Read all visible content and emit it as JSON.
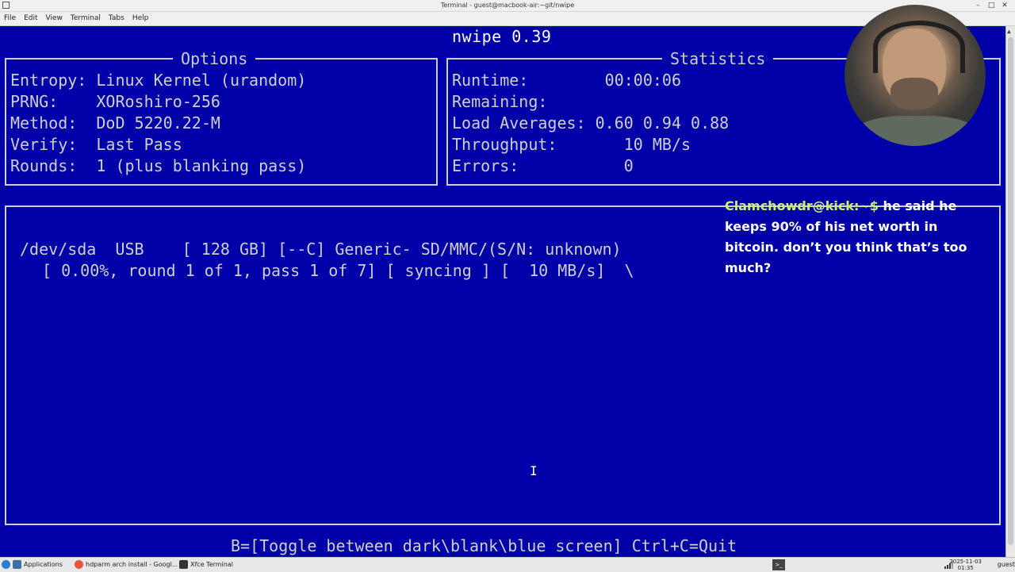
{
  "window": {
    "title": "Terminal - guest@macbook-air:~git/nwipe",
    "controls": [
      "–",
      "□",
      "✕"
    ]
  },
  "menu": [
    "File",
    "Edit",
    "View",
    "Terminal",
    "Tabs",
    "Help"
  ],
  "app": {
    "title": "nwipe 0.39"
  },
  "options": {
    "header": "Options",
    "rows": [
      "Entropy: Linux Kernel (urandom)",
      "PRNG:    XORoshiro-256",
      "Method:  DoD 5220.22-M",
      "Verify:  Last Pass",
      "Rounds:  1 (plus blanking pass)"
    ]
  },
  "statistics": {
    "header": "Statistics",
    "rows": [
      "Runtime:        00:00:06",
      "Remaining:",
      "Load Averages: 0.60 0.94 0.88",
      "Throughput:       10 MB/s",
      "Errors:           0"
    ]
  },
  "device": {
    "line1": "/dev/sda  USB    [ 128 GB] [--C] Generic- SD/MMC/(S/N: unknown)",
    "line2": "[ 0.00%, round 1 of 1, pass 1 of 7] [ syncing ] [  10 MB/s]  \\"
  },
  "footer": "B=[Toggle between dark\\blank\\blue screen] Ctrl+C=Quit",
  "chat": {
    "user": "Clamchowdr@kick:~$",
    "message": " he said he keeps 90% of his net worth in bitcoin. don’t you think that’s too much?"
  },
  "taskbar": {
    "items": [
      "Applications",
      "hdparm arch install - Googl...",
      "Xfce Terminal"
    ],
    "date": "2025-11-03",
    "time": "01:35",
    "user": "guest"
  },
  "colors": {
    "terminal_bg": "#0000a8",
    "terminal_fg": "#cfcfcf",
    "chat_user": "#c8f078"
  }
}
